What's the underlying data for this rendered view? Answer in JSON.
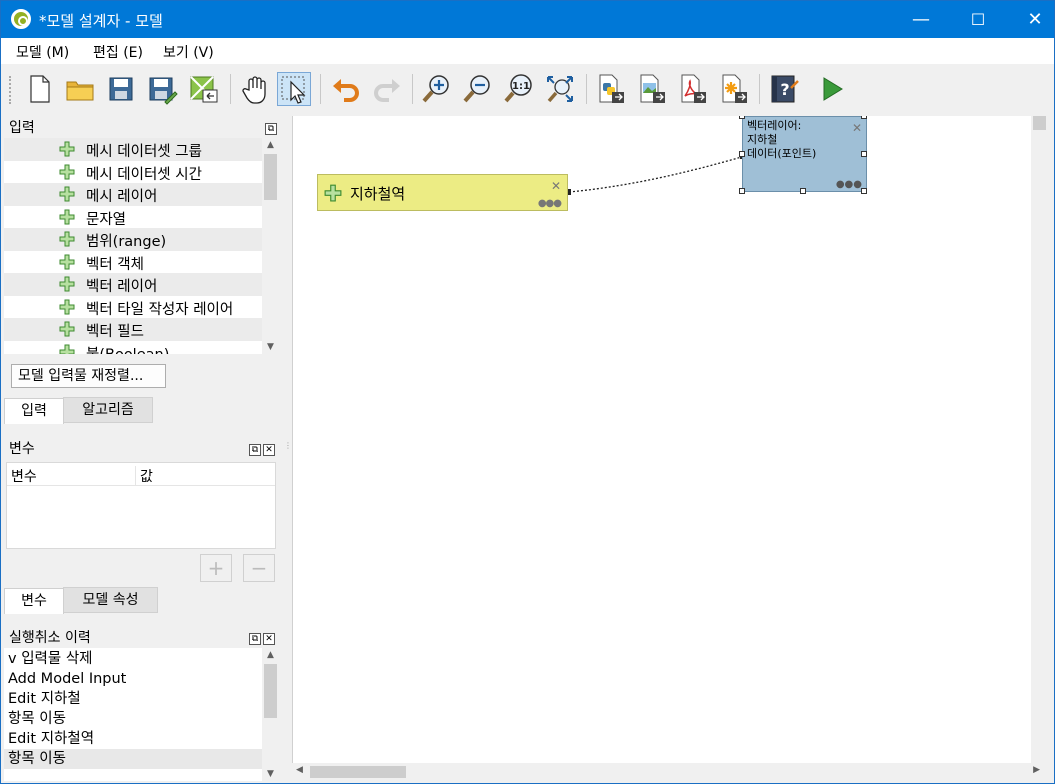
{
  "window": {
    "title": "*모델 설계자 - 모델",
    "minimize": "—",
    "maximize": "☐",
    "close": "✕"
  },
  "menu": {
    "items": [
      {
        "label": "모델 (M)"
      },
      {
        "label": "편집 (E)"
      },
      {
        "label": "보기 (V)"
      }
    ]
  },
  "toolbar": {
    "buttons": [
      {
        "icon": "new-file-icon"
      },
      {
        "icon": "open-folder-icon"
      },
      {
        "icon": "save-icon"
      },
      {
        "icon": "save-as-icon"
      },
      {
        "icon": "export-to-project-icon"
      },
      {
        "icon": "pan-hand-icon"
      },
      {
        "icon": "select-arrow-icon",
        "active": true
      },
      {
        "icon": "undo-icon"
      },
      {
        "icon": "redo-icon"
      },
      {
        "icon": "zoom-in-icon"
      },
      {
        "icon": "zoom-out-icon"
      },
      {
        "icon": "zoom-actual-icon"
      },
      {
        "icon": "zoom-full-icon"
      },
      {
        "icon": "export-python-icon"
      },
      {
        "icon": "export-image-icon"
      },
      {
        "icon": "export-pdf-icon"
      },
      {
        "icon": "export-svg-icon"
      },
      {
        "icon": "help-icon"
      },
      {
        "icon": "run-icon"
      }
    ],
    "zoom_actual_label": "1:1"
  },
  "inputs_panel": {
    "title": "입력",
    "items": [
      "메시 데이터셋 그룹",
      "메시 데이터셋 시간",
      "메시 레이어",
      "문자열",
      "범위(range)",
      "벡터 객체",
      "벡터 레이어",
      "벡터 타일 작성자 레이어",
      "벡터 필드",
      "불(Boolean)"
    ],
    "reorder_button": "모델 입력물 재정렬...",
    "tabs": [
      "입력",
      "알고리즘"
    ]
  },
  "variables_panel": {
    "title": "변수",
    "columns": [
      "변수",
      "값"
    ],
    "add": "+",
    "remove": "−",
    "tabs": [
      "변수",
      "모델 속성"
    ]
  },
  "undo_panel": {
    "title": "실행취소 이력",
    "items": [
      "v 입력물 삭제",
      "Add Model Input",
      "Edit 지하철",
      "항목 이동",
      "Edit 지하철역",
      "항목 이동"
    ]
  },
  "canvas": {
    "input_node": {
      "label": "지하철역"
    },
    "algorithm_node": {
      "label": "벡터레이어:\n지하철\n데이터(포인트)"
    }
  },
  "colors": {
    "titlebar": "#0078d7",
    "input_node": "#ecec84",
    "algorithm_node": "#9fbfd6",
    "run_green": "#3a9a3a"
  }
}
